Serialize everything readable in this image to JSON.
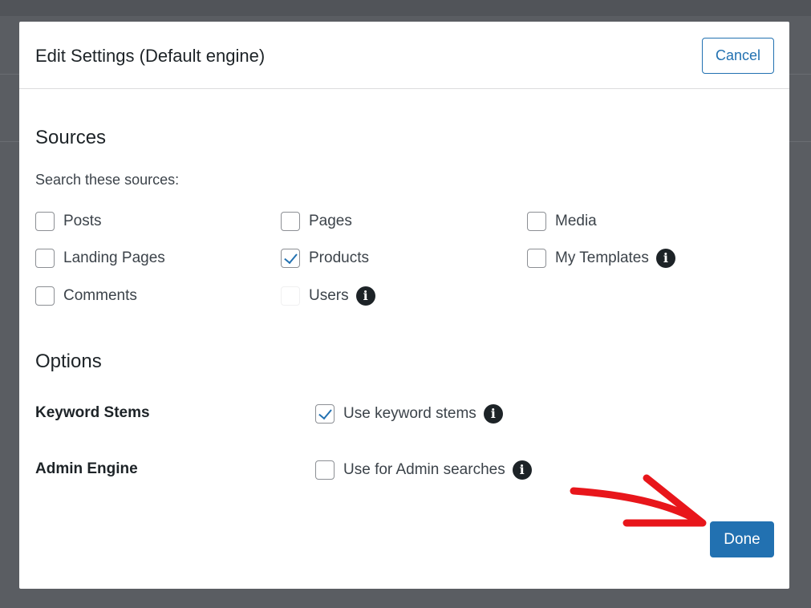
{
  "modal": {
    "title": "Edit Settings (Default engine)",
    "cancel_label": "Cancel",
    "done_label": "Done"
  },
  "sources": {
    "heading": "Sources",
    "subtext": "Search these sources:",
    "items": [
      {
        "label": "Posts",
        "checked": false
      },
      {
        "label": "Pages",
        "checked": false
      },
      {
        "label": "Media",
        "checked": false
      },
      {
        "label": "Landing Pages",
        "checked": false
      },
      {
        "label": "Products",
        "checked": true
      },
      {
        "label": "My Templates",
        "checked": false,
        "info": true
      },
      {
        "label": "Comments",
        "checked": false
      },
      {
        "label": "Users",
        "checked": false,
        "disabled": true,
        "info": true
      }
    ]
  },
  "options": {
    "heading": "Options",
    "rows": [
      {
        "label": "Keyword Stems",
        "checkbox_label": "Use keyword stems",
        "checked": true
      },
      {
        "label": "Admin Engine",
        "checkbox_label": "Use for Admin searches",
        "checked": false
      }
    ]
  },
  "colors": {
    "accent": "#2271b1",
    "annotation_arrow": "#e8161b",
    "overlay": "#5a5d62"
  },
  "icons": {
    "info": "info-circle-icon",
    "check": "checkmark-icon",
    "annotation": "red-arrow-annotation"
  }
}
